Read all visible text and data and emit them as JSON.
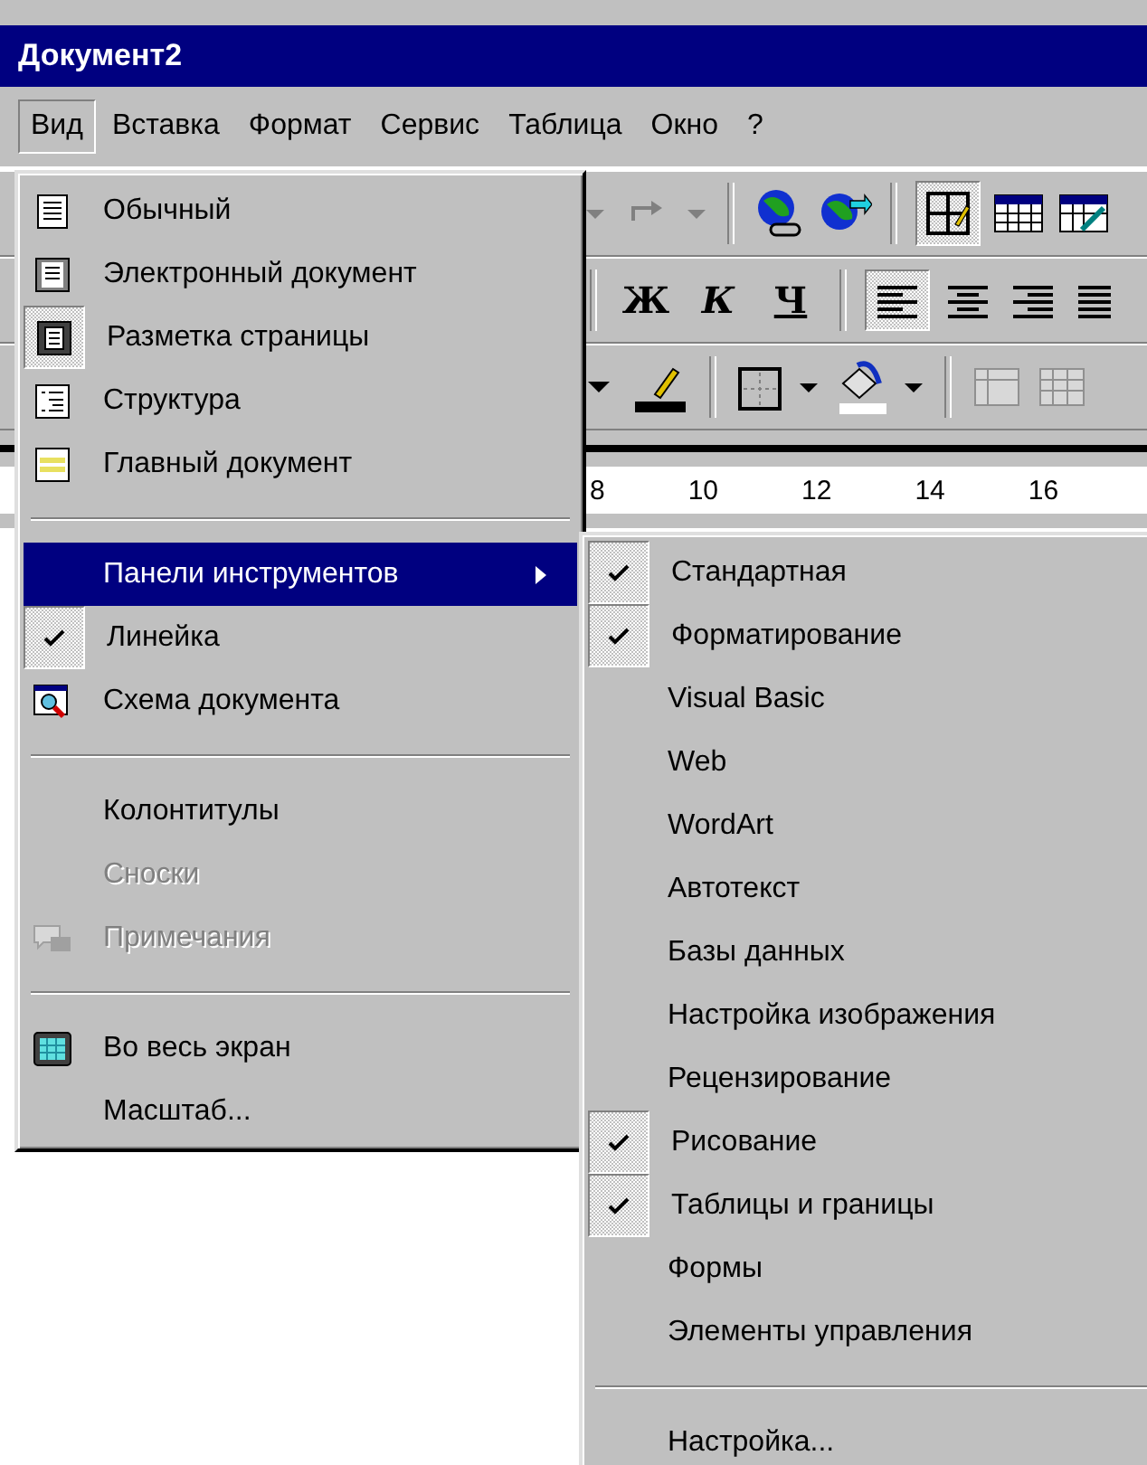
{
  "window": {
    "title": "Документ2"
  },
  "menu_bar": [
    {
      "label": "Вид",
      "selected": true
    },
    {
      "label": "Вставка",
      "selected": false
    },
    {
      "label": "Формат",
      "selected": false
    },
    {
      "label": "Сервис",
      "selected": false
    },
    {
      "label": "Таблица",
      "selected": false
    },
    {
      "label": "Окно",
      "selected": false
    },
    {
      "label": "?",
      "selected": false
    }
  ],
  "toolbar": {
    "draw_table_pressed": true,
    "align_left_pressed": true,
    "format_buttons": [
      "Ж",
      "К",
      "Ч"
    ]
  },
  "ruler": {
    "labels": [
      "8",
      "10",
      "12",
      "14",
      "16"
    ]
  },
  "view_menu": [
    {
      "kind": "command",
      "label": "Обычный",
      "selected": false,
      "disabled": false
    },
    {
      "kind": "command",
      "label": "Электронный документ",
      "selected": false,
      "disabled": false
    },
    {
      "kind": "command",
      "label": "Разметка страницы",
      "selected": true,
      "disabled": false
    },
    {
      "kind": "command",
      "label": "Структура",
      "selected": false,
      "disabled": false
    },
    {
      "kind": "command",
      "label": "Главный документ",
      "selected": false,
      "disabled": false
    },
    {
      "kind": "separator"
    },
    {
      "kind": "submenu",
      "label": "Панели инструментов",
      "highlighted": true,
      "disabled": false
    },
    {
      "kind": "command",
      "label": "Линейка",
      "checked": true,
      "disabled": false
    },
    {
      "kind": "command",
      "label": "Схема документа",
      "selected": false,
      "disabled": false
    },
    {
      "kind": "separator"
    },
    {
      "kind": "command",
      "label": "Колонтитулы",
      "disabled": false
    },
    {
      "kind": "command",
      "label": "Сноски",
      "disabled": true
    },
    {
      "kind": "command",
      "label": "Примечания",
      "disabled": true
    },
    {
      "kind": "separator"
    },
    {
      "kind": "command",
      "label": "Во весь экран",
      "selected": false,
      "disabled": false
    },
    {
      "kind": "command",
      "label": "Масштаб...",
      "disabled": false
    }
  ],
  "toolbars_menu": [
    {
      "kind": "command",
      "label": "Стандартная",
      "checked": true
    },
    {
      "kind": "command",
      "label": "Форматирование",
      "checked": true
    },
    {
      "kind": "command",
      "label": "Visual Basic",
      "checked": false
    },
    {
      "kind": "command",
      "label": "Web",
      "checked": false
    },
    {
      "kind": "command",
      "label": "WordArt",
      "checked": false
    },
    {
      "kind": "command",
      "label": "Автотекст",
      "checked": false
    },
    {
      "kind": "command",
      "label": "Базы данных",
      "checked": false
    },
    {
      "kind": "command",
      "label": "Настройка изображения",
      "checked": false
    },
    {
      "kind": "command",
      "label": "Рецензирование",
      "checked": false
    },
    {
      "kind": "command",
      "label": "Рисование",
      "checked": true
    },
    {
      "kind": "command",
      "label": "Таблицы и границы",
      "checked": true
    },
    {
      "kind": "command",
      "label": "Формы",
      "checked": false
    },
    {
      "kind": "command",
      "label": "Элементы управления",
      "checked": false
    },
    {
      "kind": "separator"
    },
    {
      "kind": "command",
      "label": "Настройка..."
    }
  ]
}
